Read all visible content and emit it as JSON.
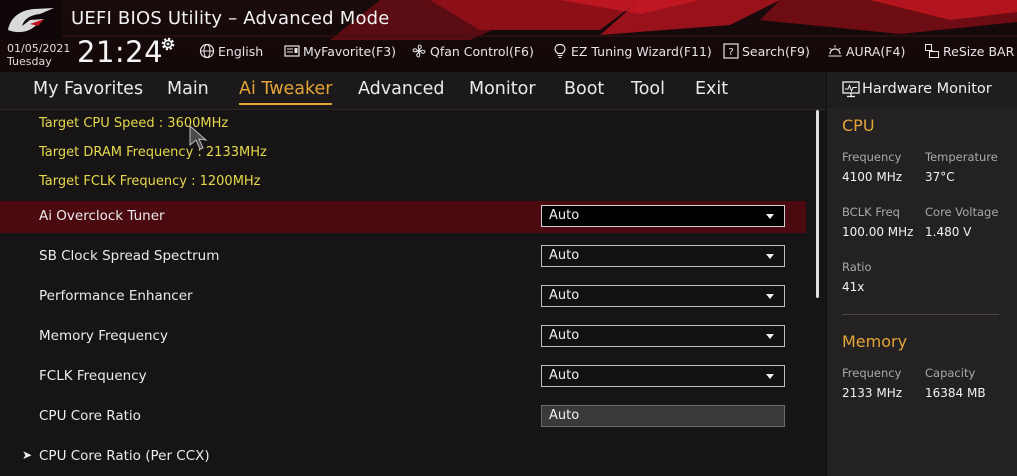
{
  "header": {
    "title": "UEFI BIOS Utility – Advanced Mode",
    "date": "01/05/2021",
    "day": "Tuesday",
    "time": "21:24",
    "toolbar": [
      {
        "label": "English",
        "icon": "globe-icon"
      },
      {
        "label": "MyFavorite(F3)",
        "icon": "favorite-icon"
      },
      {
        "label": "Qfan Control(F6)",
        "icon": "fan-icon"
      },
      {
        "label": "EZ Tuning Wizard(F11)",
        "icon": "lightbulb-icon"
      },
      {
        "label": "Search(F9)",
        "icon": "search-icon"
      },
      {
        "label": "AURA(F4)",
        "icon": "aura-icon"
      },
      {
        "label": "ReSize BAR",
        "icon": "resize-bar-icon"
      }
    ]
  },
  "nav": {
    "tabs": [
      "My Favorites",
      "Main",
      "Ai Tweaker",
      "Advanced",
      "Monitor",
      "Boot",
      "Tool",
      "Exit"
    ],
    "active": "Ai Tweaker"
  },
  "main": {
    "info": [
      "Target CPU Speed : 3600MHz",
      "Target DRAM Frequency : 2133MHz",
      "Target FCLK Frequency : 1200MHz"
    ],
    "settings": [
      {
        "label": "Ai Overclock Tuner",
        "value": "Auto"
      },
      {
        "label": "SB Clock Spread Spectrum",
        "value": "Auto"
      },
      {
        "label": "Performance Enhancer",
        "value": "Auto"
      },
      {
        "label": "Memory Frequency",
        "value": "Auto"
      },
      {
        "label": "FCLK Frequency",
        "value": "Auto"
      },
      {
        "label": "CPU Core Ratio",
        "value": "Auto"
      }
    ],
    "submenu": "CPU Core Ratio (Per CCX)"
  },
  "hw": {
    "title": "Hardware Monitor",
    "cpu": {
      "heading": "CPU",
      "frequency_label": "Frequency",
      "frequency": "4100 MHz",
      "temperature_label": "Temperature",
      "temperature": "37°C",
      "bclk_label": "BCLK Freq",
      "bclk": "100.00 MHz",
      "voltage_label": "Core Voltage",
      "voltage": "1.480 V",
      "ratio_label": "Ratio",
      "ratio": "41x"
    },
    "memory": {
      "heading": "Memory",
      "frequency_label": "Frequency",
      "frequency": "2133 MHz",
      "capacity_label": "Capacity",
      "capacity": "16384 MB"
    }
  },
  "colors": {
    "accent": "#e4a437",
    "info_text": "#e7d84c",
    "selected_row": "#4a0a10",
    "header_red": "#a0101a"
  }
}
